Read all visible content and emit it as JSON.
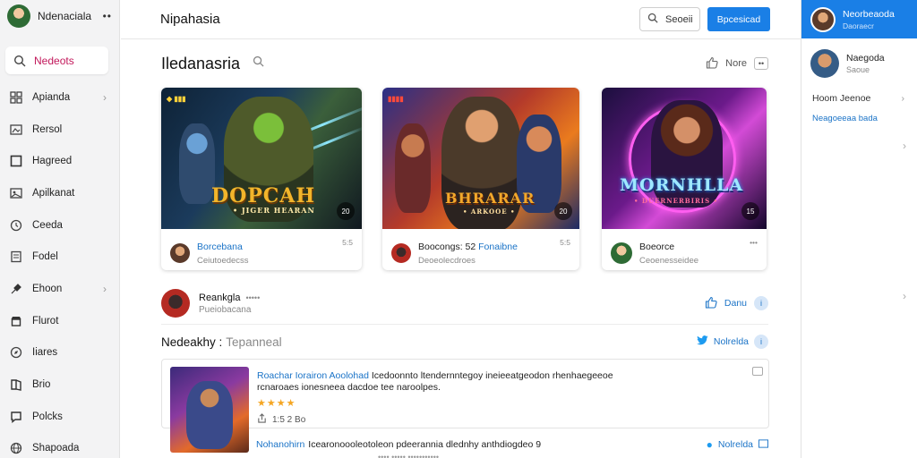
{
  "sidebar": {
    "profile_name": "Ndenaciala",
    "more": "••",
    "search_label": "Nedeots",
    "items": [
      {
        "label": "Apianda",
        "icon": "grid-icon",
        "chevron": true
      },
      {
        "label": "Rersol",
        "icon": "image-icon",
        "chevron": false
      },
      {
        "label": "Hagreed",
        "icon": "square-icon",
        "chevron": false
      },
      {
        "label": "Apilkanat",
        "icon": "photo-icon",
        "chevron": false
      },
      {
        "label": "Ceeda",
        "icon": "clock-icon",
        "chevron": false
      },
      {
        "label": "Fodel",
        "icon": "document-icon",
        "chevron": false
      },
      {
        "label": "Ehoon",
        "icon": "tool-icon",
        "chevron": true
      },
      {
        "label": "Flurot",
        "icon": "store-icon",
        "chevron": false
      },
      {
        "label": "Iiares",
        "icon": "compass-icon",
        "chevron": false
      },
      {
        "label": "Brio",
        "icon": "book-icon",
        "chevron": false
      },
      {
        "label": "Polcks",
        "icon": "chat-icon",
        "chevron": false
      },
      {
        "label": "Shapoada",
        "icon": "globe-icon",
        "chevron": false
      }
    ]
  },
  "topbar": {
    "title": "Nipahasia",
    "search_label": "Seoeii",
    "button_label": "Bpcesicad"
  },
  "main": {
    "heading": "Iledanasria",
    "heading_right": "Nore",
    "heading_more": "••",
    "cards": [
      {
        "title_art": "DOPCAH",
        "subtitle_art": "• JIGER HEARAN",
        "tag": "◆ ▮▮▮",
        "badge": "20",
        "name": "Borcebana",
        "sub": "Ceiutoedecss",
        "right": "5:5"
      },
      {
        "title_art": "BHRARAR",
        "subtitle_art": "• ARKOOE •",
        "tag": "▮▮▮▮",
        "badge": "20",
        "name": "Boocongs: 52",
        "name_extra": "Fonaibne",
        "sub": "Deoeolecdroes",
        "right": "5:5"
      },
      {
        "title_art": "MORNHLLA",
        "subtitle_art": "• DUERNERBIRIS •",
        "tag": "",
        "badge": "15",
        "name": "Boeorce",
        "sub": "Ceoenesseidee",
        "right": "•••"
      }
    ],
    "creator": {
      "name": "Reankgla",
      "name_sub": "•••••",
      "sub": "Pueiobacana",
      "like_label": "Danu",
      "info": "i"
    },
    "section": {
      "title": "Nedeakhy :",
      "subtitle": "Tepanneal",
      "right_label": "Nolrelda",
      "right_info": "i"
    },
    "post": {
      "highlight": "Roachar Iorairon Aoolohad",
      "line1_rest": "Icedoonnto ltendernntegoy ineieeatgeodon rhenhaegeeoe",
      "line2": "rcnaroaes ionesneea dacdoe tee naroolpes.",
      "stars": "★★★★",
      "stat": "1:5 2 Bo"
    },
    "post2": {
      "highlight": "Nohanohirn",
      "text": "Icearonoooleotoleon pdeerannia dlednhy anthdiogdeo 9",
      "right_label": "Nolrelda",
      "sub": "••••  •••••  •••••••••••"
    }
  },
  "rpanel": {
    "top_name": "Neorbeaoda",
    "top_sub": "Daoraecr",
    "user_name": "Naegoda",
    "user_sub": "Saoue",
    "link1": "Hoom Jeenoe",
    "link2": "Neagoeeaa bada"
  },
  "colors": {
    "accent": "#1a7fe6",
    "link": "#1a73c7",
    "star": "#f5a623"
  }
}
